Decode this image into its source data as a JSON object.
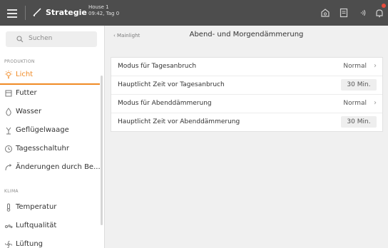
{
  "topbar": {
    "app_title": "Strategie",
    "house_line1": "House 1",
    "house_line2": "09:42, Tag 0"
  },
  "sidebar": {
    "search_placeholder": "Suchen",
    "section_production": "PRODUKTION",
    "section_climate": "KLIMA",
    "items": [
      {
        "label": "Licht",
        "icon": "lightbulb-icon",
        "active": true
      },
      {
        "label": "Futter",
        "icon": "feed-icon"
      },
      {
        "label": "Wasser",
        "icon": "water-drop-icon"
      },
      {
        "label": "Geflügelwaage",
        "icon": "scale-icon"
      },
      {
        "label": "Tagesschaltuhr",
        "icon": "clock-icon"
      },
      {
        "label": "Änderungen durch Be...",
        "icon": "changes-icon"
      }
    ],
    "climate_items": [
      {
        "label": "Temperatur",
        "icon": "thermometer-icon"
      },
      {
        "label": "Luftqualität",
        "icon": "air-quality-icon"
      },
      {
        "label": "Lüftung",
        "icon": "fan-icon"
      }
    ]
  },
  "main": {
    "breadcrumb": "Mainlight",
    "title": "Abend- und Morgendämmerung",
    "rows": [
      {
        "label": "Modus für Tagesanbruch",
        "value": "Normal",
        "type": "select"
      },
      {
        "label": "Hauptlicht Zeit vor Tagesanbruch",
        "value": "30 Min.",
        "type": "input"
      },
      {
        "label": "Modus für Abenddämmerung",
        "value": "Normal",
        "type": "select"
      },
      {
        "label": "Hauptlicht Zeit vor Abenddämmerung",
        "value": "30 Min.",
        "type": "input"
      }
    ]
  },
  "colors": {
    "accent": "#f08a24",
    "topbar": "#4d4d4d",
    "badge": "#e74c3c"
  }
}
